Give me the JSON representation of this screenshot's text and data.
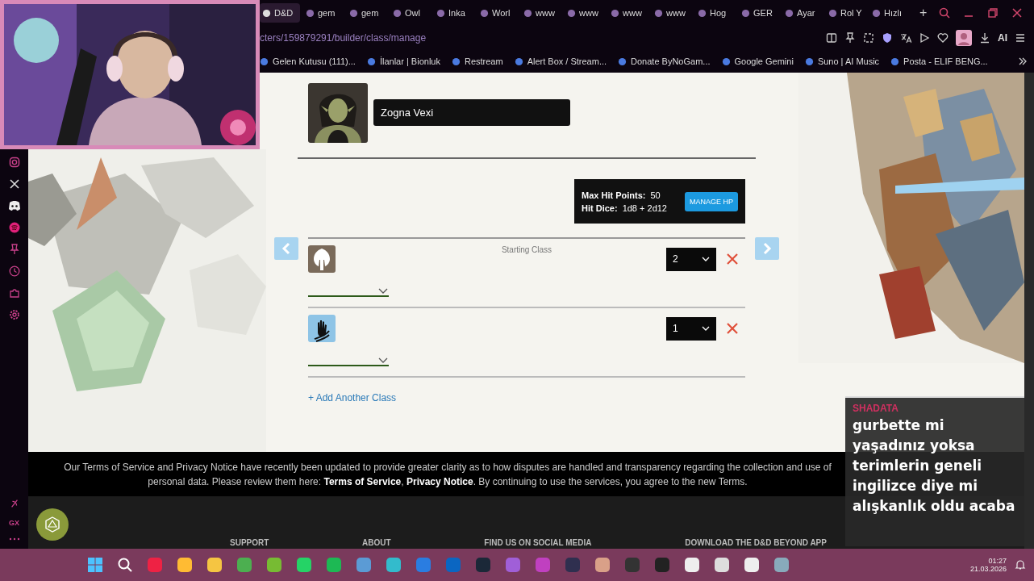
{
  "browser": {
    "tabs": [
      {
        "label": "D&D",
        "selected": true
      },
      {
        "label": "gem",
        "selected": false
      },
      {
        "label": "gem",
        "selected": false
      },
      {
        "label": "Owl",
        "selected": false
      },
      {
        "label": "Inka",
        "selected": false
      },
      {
        "label": "Worl",
        "selected": false
      },
      {
        "label": "www",
        "selected": false
      },
      {
        "label": "www",
        "selected": false
      },
      {
        "label": "www",
        "selected": false
      },
      {
        "label": "www",
        "selected": false
      },
      {
        "label": "Hog",
        "selected": false
      },
      {
        "label": "GER",
        "selected": false
      },
      {
        "label": "Ayar",
        "selected": false
      },
      {
        "label": "Rol Y",
        "selected": false
      },
      {
        "label": "Hızlı",
        "selected": false
      }
    ],
    "new_tab": "+",
    "address": "cters/159879291/builder/class/manage",
    "ai_label": "AI",
    "bookmarks": [
      "Gelen Kutusu (111)...",
      "İlanlar | Bionluk",
      "Restream",
      "Alert Box / Stream...",
      "Donate ByNoGam...",
      "Google Gemini",
      "Suno | AI Music",
      "Posta - ELIF BENG..."
    ]
  },
  "character": {
    "name": "Zogna Vexi"
  },
  "hit_points": {
    "max_label": "Max Hit Points:",
    "max_value": "50",
    "dice_label": "Hit Dice:",
    "dice_value": "1d8 + 2d12",
    "button": "MANAGE HP"
  },
  "classes": [
    {
      "kind": "warrior",
      "caption": "Starting Class",
      "level": "2"
    },
    {
      "kind": "monk",
      "level": "1"
    }
  ],
  "add_class": "+ Add Another Class",
  "notice": {
    "lead": "Our Terms of Service and Privacy Notice have recently been updated to provide greater clarity as to how disputes are handled and transparency regarding the collection and use of personal data. Please review them here: ",
    "links": [
      "Terms of Service",
      "Privacy Notice"
    ],
    "separator": ",",
    "tail": ". By continuing to use the services, you agree to the new Terms."
  },
  "footer_headings": [
    "SUPPORT",
    "ABOUT",
    "FIND US ON SOCIAL MEDIA",
    "DOWNLOAD THE D&D BEYOND APP"
  ],
  "chat": {
    "user": "SHADATA",
    "message": "gurbette mi yaşadınız yoksa terimlerin geneli ingilizce diye mi alışkanlık oldu acaba"
  },
  "sidebar": {
    "footer_label": "GX"
  },
  "taskbar": {
    "time": "01:27",
    "date": "21.03.2026"
  }
}
